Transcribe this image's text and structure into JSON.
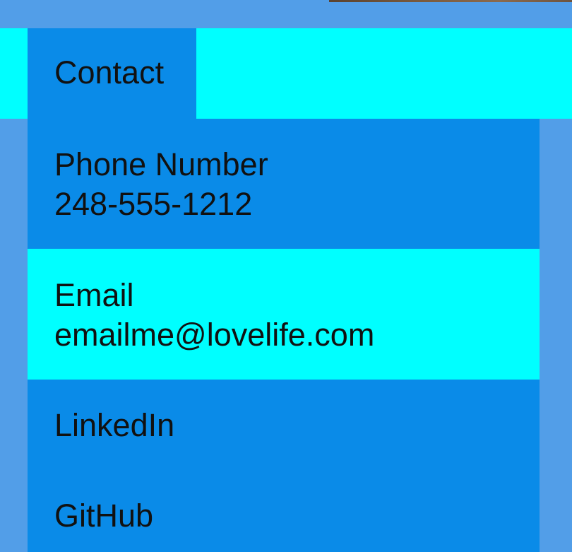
{
  "colors": {
    "page_background": "#529EE8",
    "panel_background": "#0A8BE8",
    "highlight_background": "#00FFFF",
    "text": "#111111"
  },
  "contact": {
    "title": "Contact",
    "phone": {
      "label": "Phone Number",
      "value": "248-555-1212"
    },
    "email": {
      "label": "Email",
      "value": "emailme@lovelife.com"
    },
    "linkedin": {
      "label": "LinkedIn"
    },
    "github": {
      "label": "GitHub"
    }
  }
}
